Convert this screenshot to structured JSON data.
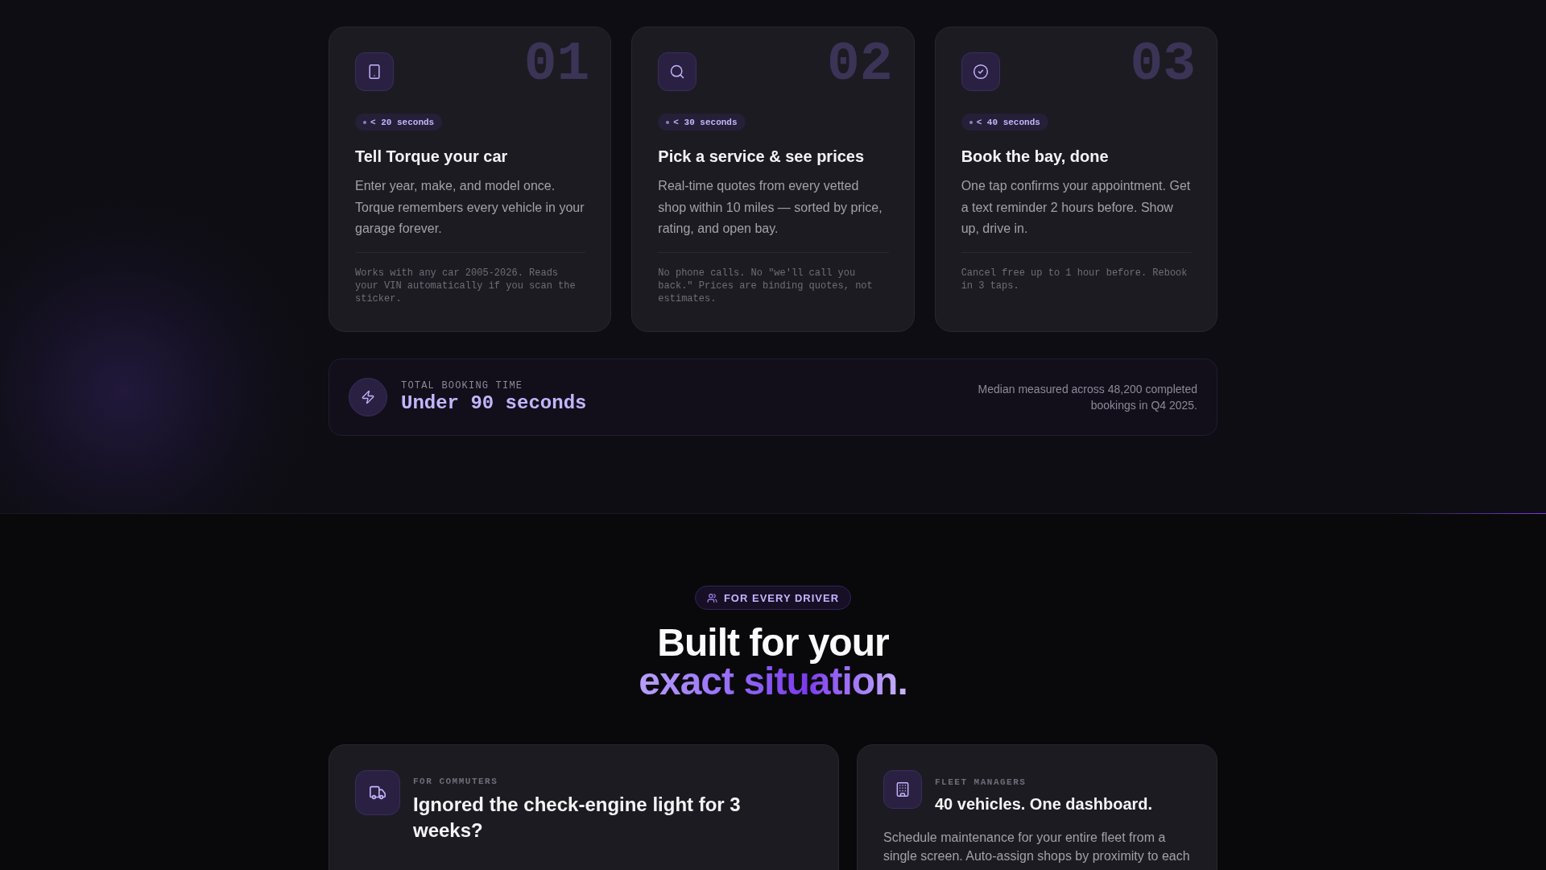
{
  "steps": [
    {
      "number": "01",
      "duration": "< 20 seconds",
      "title": "Tell Torque your car",
      "description": "Enter year, make, and model once. Torque remembers every vehicle in your garage forever.",
      "note": "Works with any car 2005-2026. Reads your VIN automatically if you scan the sticker."
    },
    {
      "number": "02",
      "duration": "< 30 seconds",
      "title": "Pick a service & see prices",
      "description": "Real-time quotes from every vetted shop within 10 miles — sorted by price, rating, and open bay.",
      "note": "No phone calls. No \"we'll call you back.\" Prices are binding quotes, not estimates."
    },
    {
      "number": "03",
      "duration": "< 40 seconds",
      "title": "Book the bay, done",
      "description": "One tap confirms your appointment. Get a text reminder 2 hours before. Show up, drive in.",
      "note": "Cancel free up to 1 hour before. Rebook in 3 taps."
    }
  ],
  "total_time": {
    "label": "TOTAL BOOKING TIME",
    "value": "Under 90 seconds",
    "note": "Median measured across 48,200 completed bookings in Q4 2025."
  },
  "audience": {
    "tag": "FOR EVERY DRIVER",
    "heading": "Built for your",
    "heading_highlight": "exact situation.",
    "cards": [
      {
        "kind": "featured",
        "label": "FOR COMMUTERS",
        "title": "Ignored the check-engine light for 3 weeks?"
      },
      {
        "kind": "standard",
        "label": "FLEET MANAGERS",
        "title": "40 vehicles. One dashboard.",
        "description": "Schedule maintenance for your entire fleet from a single screen. Auto-assign shops by proximity to each"
      }
    ]
  }
}
